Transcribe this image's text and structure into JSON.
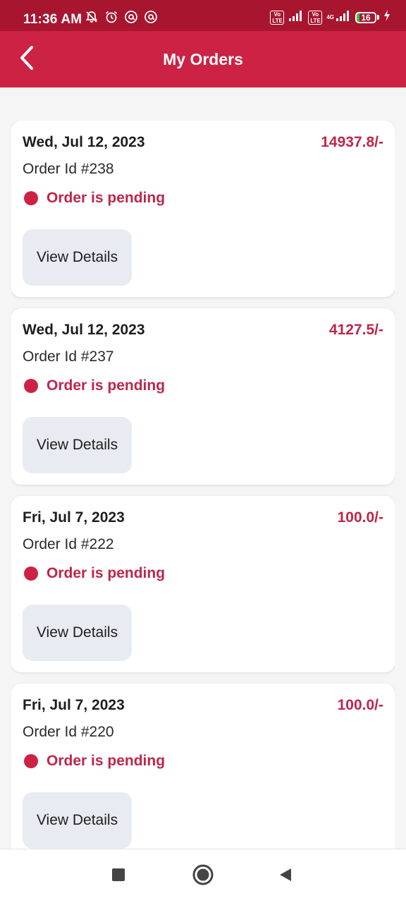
{
  "status_bar": {
    "time": "11:36 AM",
    "left_icons": [
      "mute-bell-icon",
      "alarm-icon",
      "at-sign-icon",
      "at-sign-icon"
    ],
    "volte1": "Vo LTE",
    "volte2": "Vo LTE",
    "network_type": "4G",
    "battery": "16",
    "battery_level": 0.16,
    "charging_icon": "lightning-icon"
  },
  "app_bar": {
    "title": "My Orders",
    "back_icon": "chevron-left-icon"
  },
  "orders": [
    {
      "date": "Wed, Jul 12, 2023",
      "amount": "14937.8/-",
      "order_id": "Order Id #238",
      "status": "Order is pending",
      "button": "View Details"
    },
    {
      "date": "Wed, Jul 12, 2023",
      "amount": "4127.5/-",
      "order_id": "Order Id #237",
      "status": "Order is pending",
      "button": "View Details"
    },
    {
      "date": "Fri, Jul 7, 2023",
      "amount": "100.0/-",
      "order_id": "Order Id #222",
      "status": "Order is pending",
      "button": "View Details"
    },
    {
      "date": "Fri, Jul 7, 2023",
      "amount": "100.0/-",
      "order_id": "Order Id #220",
      "status": "Order is pending",
      "button": "View Details"
    }
  ],
  "nav_bar": {
    "icons": [
      "recents-square-icon",
      "home-circle-icon",
      "back-triangle-icon"
    ]
  },
  "colors": {
    "status_bar": "#a8152f",
    "app_bar": "#cc2244",
    "accent_text": "#c0254a",
    "button_bg": "#e8ebf1",
    "background": "#f5f5f6"
  }
}
